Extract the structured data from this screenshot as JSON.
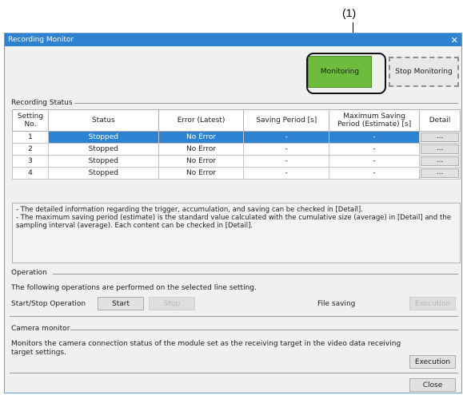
{
  "callout": "(1)",
  "window": {
    "title": "Recording Monitor"
  },
  "buttons": {
    "monitoring": "Monitoring",
    "stop_monitoring": "Stop Monitoring",
    "close": "Close"
  },
  "recording_status": {
    "label": "Recording Status",
    "columns": [
      "Setting No.",
      "Status",
      "Error (Latest)",
      "Saving Period [s]",
      "Maximum Saving Period (Estimate) [s]",
      "Detail"
    ],
    "rows": [
      {
        "no": "1",
        "status": "Stopped",
        "error": "No Error",
        "saving": "-",
        "max": "-",
        "detail": "..."
      },
      {
        "no": "2",
        "status": "Stopped",
        "error": "No Error",
        "saving": "-",
        "max": "-",
        "detail": "..."
      },
      {
        "no": "3",
        "status": "Stopped",
        "error": "No Error",
        "saving": "-",
        "max": "-",
        "detail": "..."
      },
      {
        "no": "4",
        "status": "Stopped",
        "error": "No Error",
        "saving": "-",
        "max": "-",
        "detail": "..."
      }
    ],
    "notes": [
      "- The detailed information regarding the trigger, accumulation, and saving can be checked in [Detail].",
      "- The maximum saving period (estimate) is the standard value calculated with the cumulative size (average) in [Detail] and the sampling interval (average). Each content can be checked in [Detail]."
    ]
  },
  "operation": {
    "label": "Operation",
    "description": "The following operations are performed on the selected line setting.",
    "start_stop_label": "Start/Stop Operation",
    "start": "Start",
    "stop": "Stop",
    "file_saving_label": "File saving",
    "execution": "Execution"
  },
  "camera_monitor": {
    "label": "Camera monitor",
    "description": "Monitors the camera connection status of the module set as the receiving target in the video data receiving target settings.",
    "execution": "Execution"
  }
}
